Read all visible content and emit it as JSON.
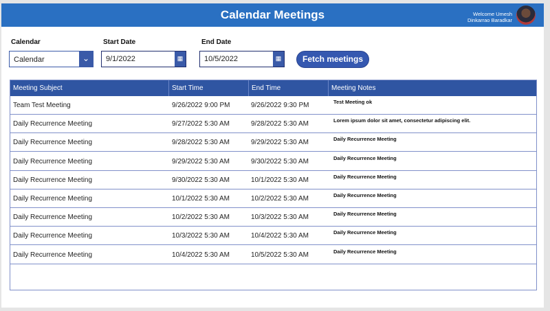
{
  "header": {
    "title": "Calendar Meetings",
    "welcome_line1": "Welcome Umesh",
    "welcome_line2": "Dinkarrao Baradkar"
  },
  "filters": {
    "calendar_label": "Calendar",
    "calendar_value": "Calendar",
    "start_label": "Start Date",
    "start_value": "9/1/2022",
    "end_label": "End Date",
    "end_value": "10/5/2022",
    "fetch_label": "Fetch meetings"
  },
  "table": {
    "columns": [
      "Meeting Subject",
      "Start Time",
      "End Time",
      "Meeting Notes"
    ],
    "rows": [
      [
        "Team Test Meeting",
        "9/26/2022 9:00 PM",
        "9/26/2022 9:30 PM",
        "Test Meeting ok"
      ],
      [
        "Daily Recurrence Meeting",
        "9/27/2022 5:30 AM",
        "9/28/2022 5:30 AM",
        "Lorem ipsum dolor sit amet, consectetur adipiscing elit."
      ],
      [
        "Daily Recurrence Meeting",
        "9/28/2022 5:30 AM",
        "9/29/2022 5:30 AM",
        "Daily Recurrence Meeting"
      ],
      [
        "Daily Recurrence Meeting",
        "9/29/2022 5:30 AM",
        "9/30/2022 5:30 AM",
        "Daily Recurrence Meeting"
      ],
      [
        "Daily Recurrence Meeting",
        "9/30/2022 5:30 AM",
        "10/1/2022 5:30 AM",
        "Daily Recurrence Meeting"
      ],
      [
        "Daily Recurrence Meeting",
        "10/1/2022 5:30 AM",
        "10/2/2022 5:30 AM",
        "Daily Recurrence Meeting"
      ],
      [
        "Daily Recurrence Meeting",
        "10/2/2022 5:30 AM",
        "10/3/2022 5:30 AM",
        "Daily Recurrence Meeting"
      ],
      [
        "Daily Recurrence Meeting",
        "10/3/2022 5:30 AM",
        "10/4/2022 5:30 AM",
        "Daily Recurrence Meeting"
      ],
      [
        "Daily Recurrence Meeting",
        "10/4/2022 5:30 AM",
        "10/5/2022 5:30 AM",
        "Daily Recurrence Meeting"
      ]
    ]
  }
}
